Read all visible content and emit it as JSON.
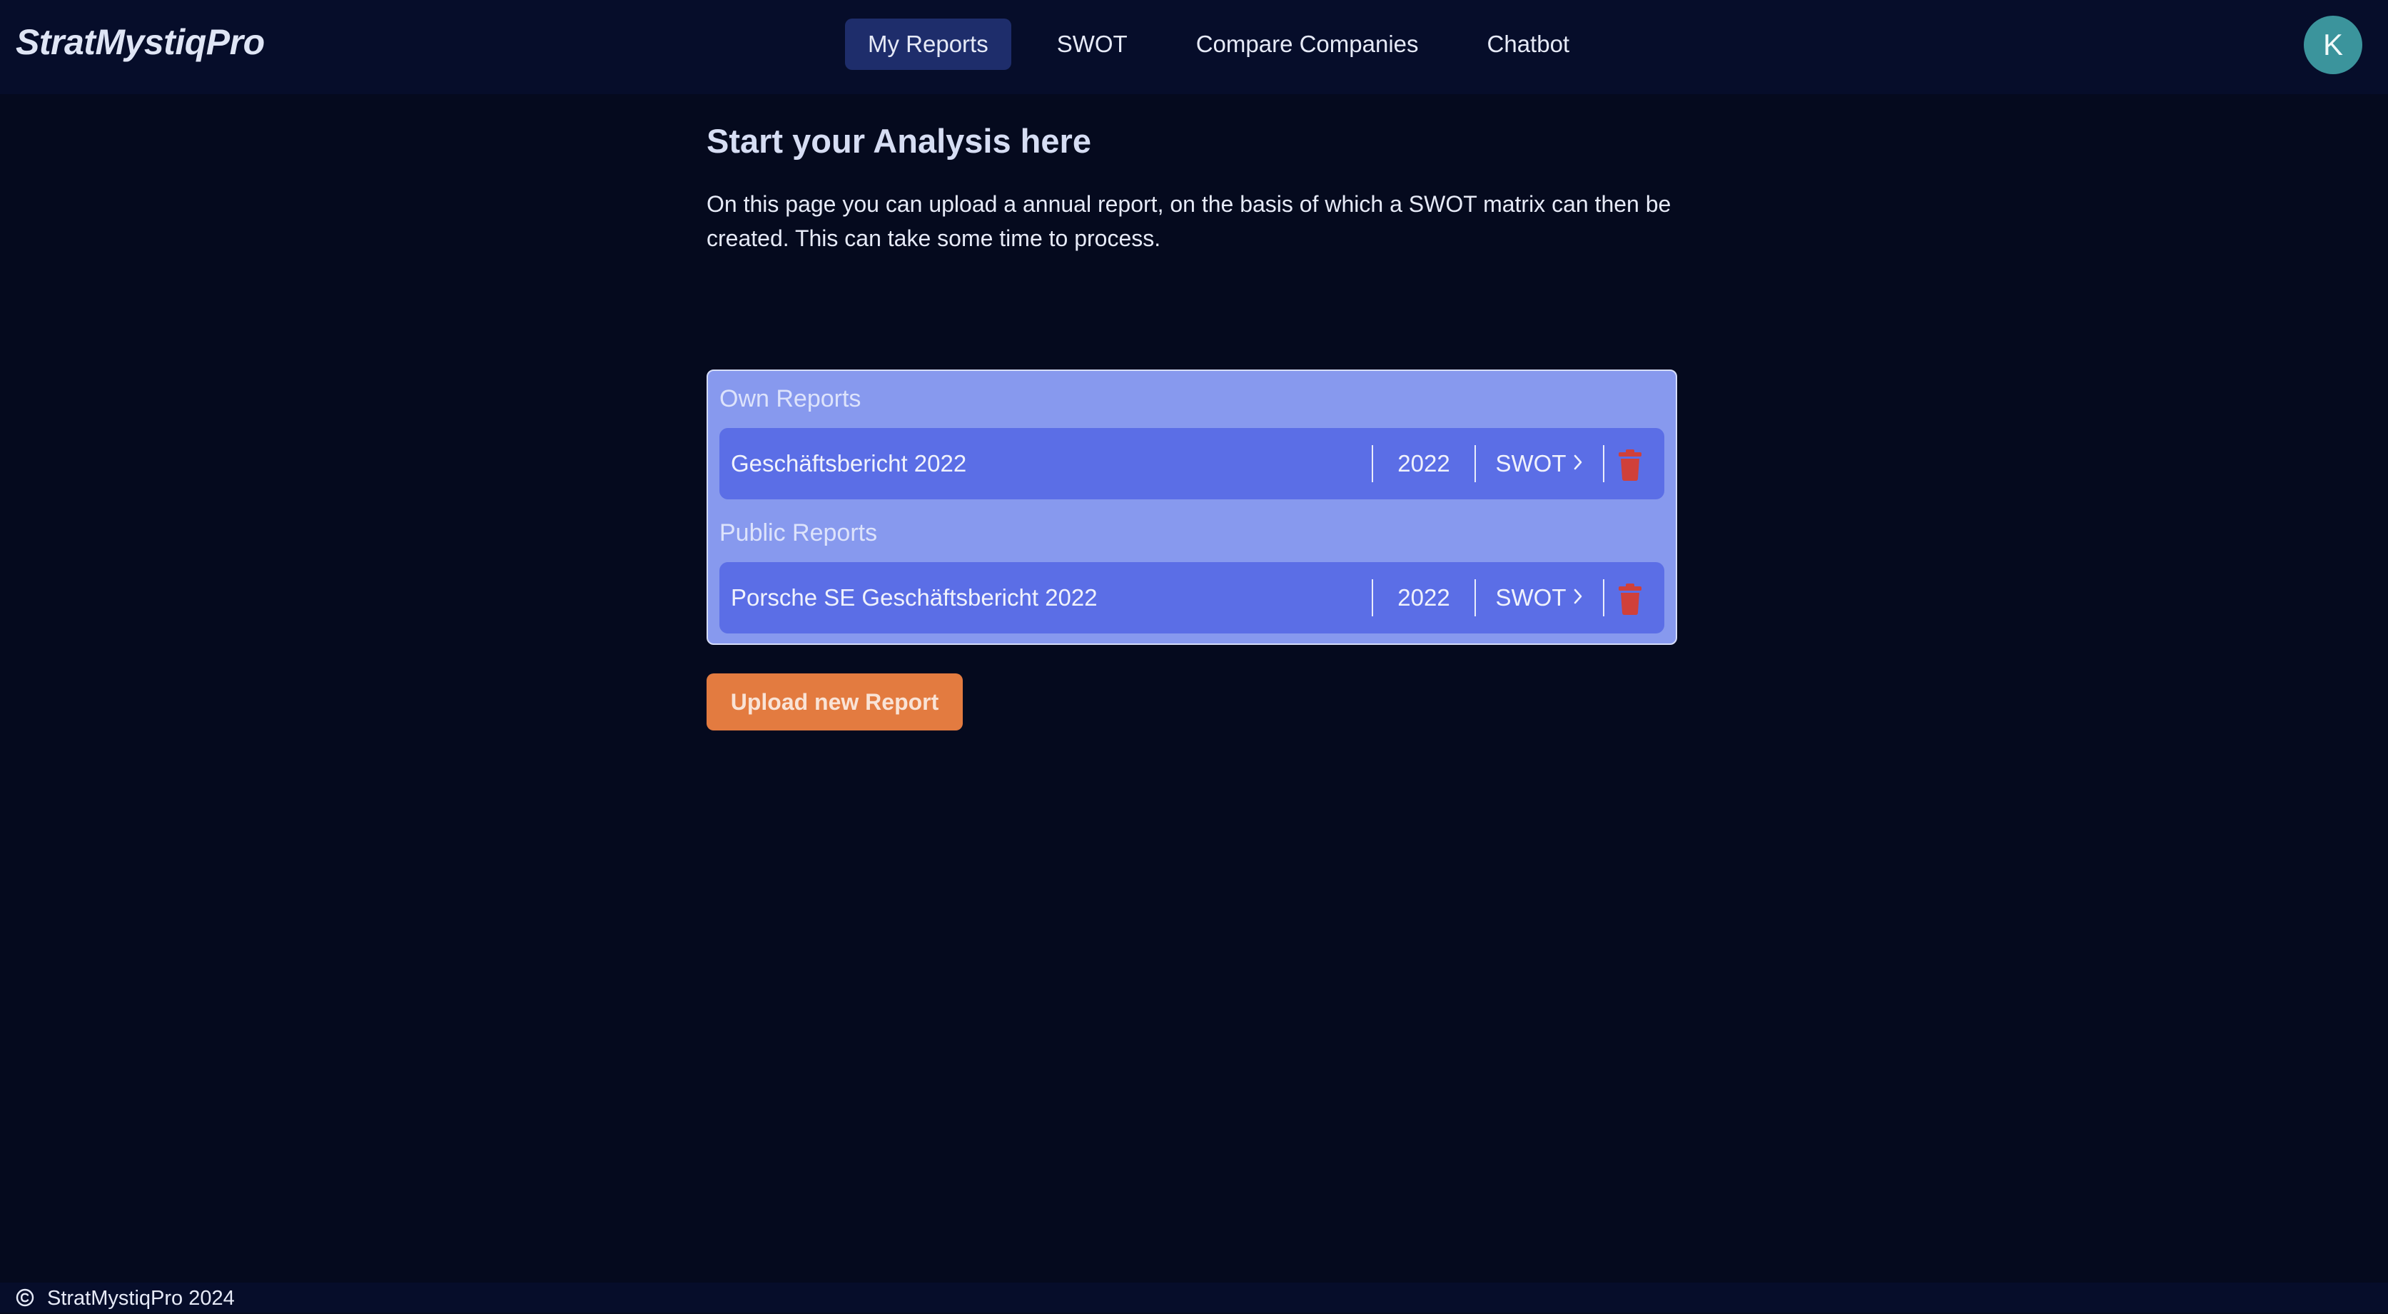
{
  "app": {
    "logo": "StratMystiqPro"
  },
  "nav": {
    "items": [
      {
        "label": "My Reports",
        "active": true
      },
      {
        "label": "SWOT",
        "active": false
      },
      {
        "label": "Compare Companies",
        "active": false
      },
      {
        "label": "Chatbot",
        "active": false
      }
    ]
  },
  "user": {
    "avatar_initial": "K"
  },
  "main": {
    "title": "Start your Analysis here",
    "intro": "On this page you can upload a annual report, on the basis of which a SWOT matrix can then be created. This can take some time to process."
  },
  "reports": {
    "own": {
      "label": "Own Reports",
      "items": [
        {
          "name": "Geschäftsbericht 2022",
          "year": "2022",
          "action": "SWOT"
        }
      ]
    },
    "public": {
      "label": "Public Reports",
      "items": [
        {
          "name": "Porsche SE Geschäftsbericht 2022",
          "year": "2022",
          "action": "SWOT"
        }
      ]
    }
  },
  "actions": {
    "upload_label": "Upload new Report"
  },
  "footer": {
    "text": "StratMystiqPro 2024"
  },
  "icons": {
    "chevron": "chevron-right-icon",
    "delete": "trash-icon",
    "copyright": "copyright-icon"
  },
  "colors": {
    "background": "#050a1e",
    "header": "#060d2a",
    "nav_active": "#1e2d6b",
    "panel": "#8799ee",
    "row": "#5b6ee6",
    "delete": "#d0403a",
    "upload_button": "#e37b40",
    "avatar": "#3b949c"
  }
}
